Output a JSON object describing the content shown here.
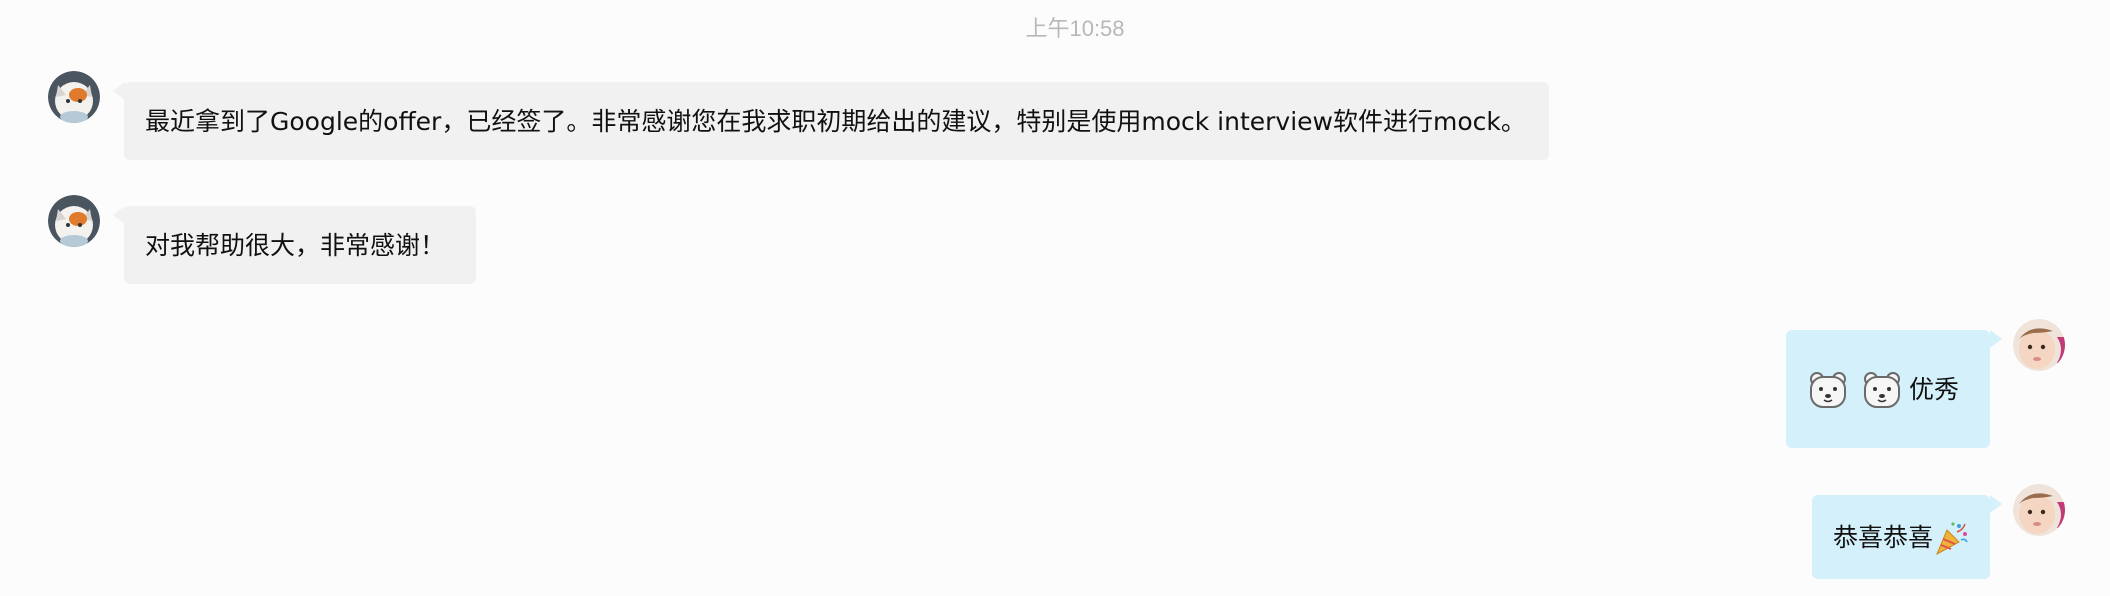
{
  "chat": {
    "timestamp": "上午10:58",
    "messages": [
      {
        "sender": "other",
        "text": "最近拿到了Google的offer，已经签了。非常感谢您在我求职初期给出的建议，特别是使用mock interview软件进行mock。"
      },
      {
        "sender": "self-other",
        "text": "对我帮助很大，非常感谢！"
      },
      {
        "sender": "me",
        "emojis": [
          "polar-bear-icon",
          "polar-bear-icon"
        ],
        "text": "优秀"
      },
      {
        "sender": "me",
        "text": "恭喜恭喜",
        "emoji": "party-popper-icon"
      }
    ]
  },
  "colors": {
    "incoming_bubble": "#f1f1f1",
    "outgoing_bubble": "#d4f0fb",
    "timestamp": "#b8b8b8",
    "background": "#fcfcfc"
  }
}
